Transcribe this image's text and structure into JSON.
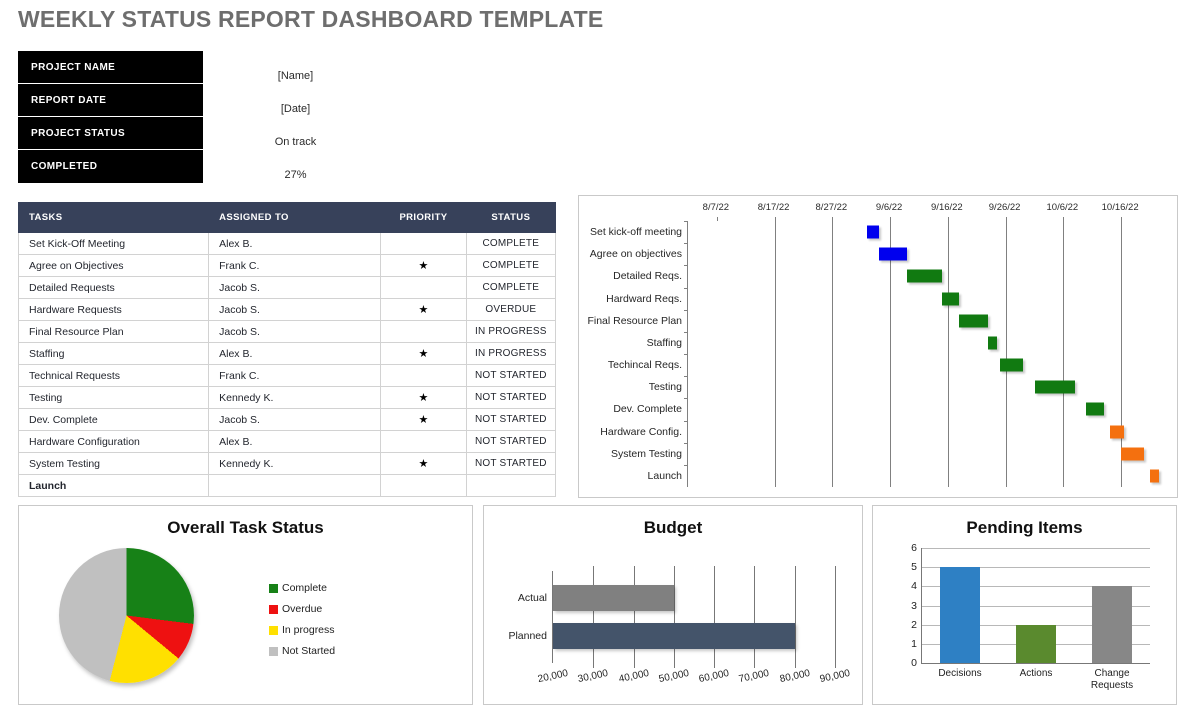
{
  "page_title": "WEEKLY STATUS REPORT DASHBOARD TEMPLATE",
  "info": {
    "rows": [
      {
        "label": "PROJECT NAME",
        "value": "[Name]"
      },
      {
        "label": "REPORT DATE",
        "value": "[Date]"
      },
      {
        "label": "PROJECT STATUS",
        "value": "On track"
      },
      {
        "label": "COMPLETED",
        "value": "27%"
      }
    ]
  },
  "tasks_table": {
    "headers": [
      "TASKS",
      "ASSIGNED TO",
      "PRIORITY",
      "STATUS"
    ],
    "priority_marker": "★",
    "rows": [
      {
        "task": "Set Kick-Off Meeting",
        "assigned": "Alex B.",
        "priority": "",
        "status": "COMPLETE",
        "status_key": "complete"
      },
      {
        "task": "Agree on Objectives",
        "assigned": "Frank C.",
        "priority": "★",
        "status": "COMPLETE",
        "status_key": "complete"
      },
      {
        "task": "Detailed Requests",
        "assigned": "Jacob S.",
        "priority": "",
        "status": "COMPLETE",
        "status_key": "complete"
      },
      {
        "task": "Hardware Requests",
        "assigned": "Jacob S.",
        "priority": "★",
        "status": "OVERDUE",
        "status_key": "overdue"
      },
      {
        "task": "Final Resource Plan",
        "assigned": "Jacob S.",
        "priority": "",
        "status": "IN PROGRESS",
        "status_key": "inprogress"
      },
      {
        "task": "Staffing",
        "assigned": "Alex B.",
        "priority": "★",
        "status": "IN PROGRESS",
        "status_key": "inprogress"
      },
      {
        "task": "Technical Requests",
        "assigned": "Frank C.",
        "priority": "",
        "status": "NOT STARTED",
        "status_key": "notstarted"
      },
      {
        "task": "Testing",
        "assigned": "Kennedy K.",
        "priority": "★",
        "status": "NOT STARTED",
        "status_key": "notstarted"
      },
      {
        "task": "Dev. Complete",
        "assigned": "Jacob S.",
        "priority": "★",
        "status": "NOT STARTED",
        "status_key": "notstarted"
      },
      {
        "task": "Hardware Configuration",
        "assigned": "Alex B.",
        "priority": "",
        "status": "NOT STARTED",
        "status_key": "notstarted"
      },
      {
        "task": "System Testing",
        "assigned": "Kennedy K.",
        "priority": "★",
        "status": "NOT STARTED",
        "status_key": "notstarted"
      },
      {
        "task": "Launch",
        "assigned": "",
        "priority": "",
        "status": "",
        "status_key": "launch"
      }
    ]
  },
  "chart_data": [
    {
      "type": "bar",
      "name": "gantt",
      "title": "",
      "orientation": "horizontal-timeline",
      "xlabel": "",
      "ylabel": "",
      "axis_ticks": [
        "8/7/22",
        "8/17/22",
        "8/27/22",
        "9/6/22",
        "9/16/22",
        "9/26/22",
        "10/6/22",
        "10/16/22"
      ],
      "axis_start": "8/2/22",
      "axis_end": "10/21/22",
      "axis_days": 80,
      "tick_interval_days": 10,
      "grid": true,
      "categories": [
        "Set kick-off meeting",
        "Agree on objectives",
        "Detailed Reqs.",
        "Hardward Reqs.",
        "Final Resource Plan",
        "Staffing",
        "Techincal Reqs.",
        "Testing",
        "Dev. Complete",
        "Hardware Config.",
        "System Testing",
        "Launch"
      ],
      "bars": [
        {
          "label": "Set kick-off meeting",
          "start_day": 31,
          "duration_days": 2,
          "color": "#0000ee"
        },
        {
          "label": "Agree on objectives",
          "start_day": 33,
          "duration_days": 5,
          "color": "#0000ee"
        },
        {
          "label": "Detailed Reqs.",
          "start_day": 38,
          "duration_days": 6,
          "color": "#117a11"
        },
        {
          "label": "Hardward Reqs.",
          "start_day": 44,
          "duration_days": 3,
          "color": "#117a11"
        },
        {
          "label": "Final Resource Plan",
          "start_day": 47,
          "duration_days": 5,
          "color": "#117a11"
        },
        {
          "label": "Staffing",
          "start_day": 52,
          "duration_days": 1.5,
          "color": "#117a11"
        },
        {
          "label": "Techincal Reqs.",
          "start_day": 54,
          "duration_days": 4,
          "color": "#117a11"
        },
        {
          "label": "Testing",
          "start_day": 60,
          "duration_days": 7,
          "color": "#117a11"
        },
        {
          "label": "Dev. Complete",
          "start_day": 69,
          "duration_days": 3,
          "color": "#117a11"
        },
        {
          "label": "Hardware Config.",
          "start_day": 73,
          "duration_days": 2.5,
          "color": "#f4700f"
        },
        {
          "label": "System Testing",
          "start_day": 75,
          "duration_days": 4,
          "color": "#f4700f"
        },
        {
          "label": "Launch",
          "start_day": 80,
          "duration_days": 1.5,
          "color": "#f4700f"
        }
      ]
    },
    {
      "type": "pie",
      "name": "overall-task-status",
      "title": "Overall Task Status",
      "legend_position": "right",
      "labels": [
        "Complete",
        "Overdue",
        "In progress",
        "Not Started"
      ],
      "values": [
        27,
        9,
        18,
        46
      ],
      "colors": [
        "#178117",
        "#ee1111",
        "#ffe000",
        "#c0c0c0"
      ]
    },
    {
      "type": "bar",
      "name": "budget",
      "title": "Budget",
      "orientation": "horizontal",
      "categories": [
        "Actual",
        "Planned"
      ],
      "values": [
        50000,
        80000
      ],
      "colors": [
        "#808080",
        "#44546a"
      ],
      "xlabel": "",
      "ylabel": "",
      "xlim": [
        20000,
        90000
      ],
      "xtick_labels": [
        "20,000",
        "30,000",
        "40,000",
        "50,000",
        "60,000",
        "70,000",
        "80,000",
        "90,000"
      ],
      "grid": true
    },
    {
      "type": "bar",
      "name": "pending-items",
      "title": "Pending Items",
      "orientation": "vertical",
      "categories": [
        "Decisions",
        "Actions",
        "Change Requests"
      ],
      "values": [
        5,
        2,
        4
      ],
      "colors": [
        "#2e80c4",
        "#5a8a2e",
        "#878787"
      ],
      "xlabel": "",
      "ylabel": "",
      "ylim": [
        0,
        6
      ],
      "ytick_labels": [
        "0",
        "1",
        "2",
        "3",
        "4",
        "5",
        "6"
      ],
      "grid": true
    }
  ]
}
